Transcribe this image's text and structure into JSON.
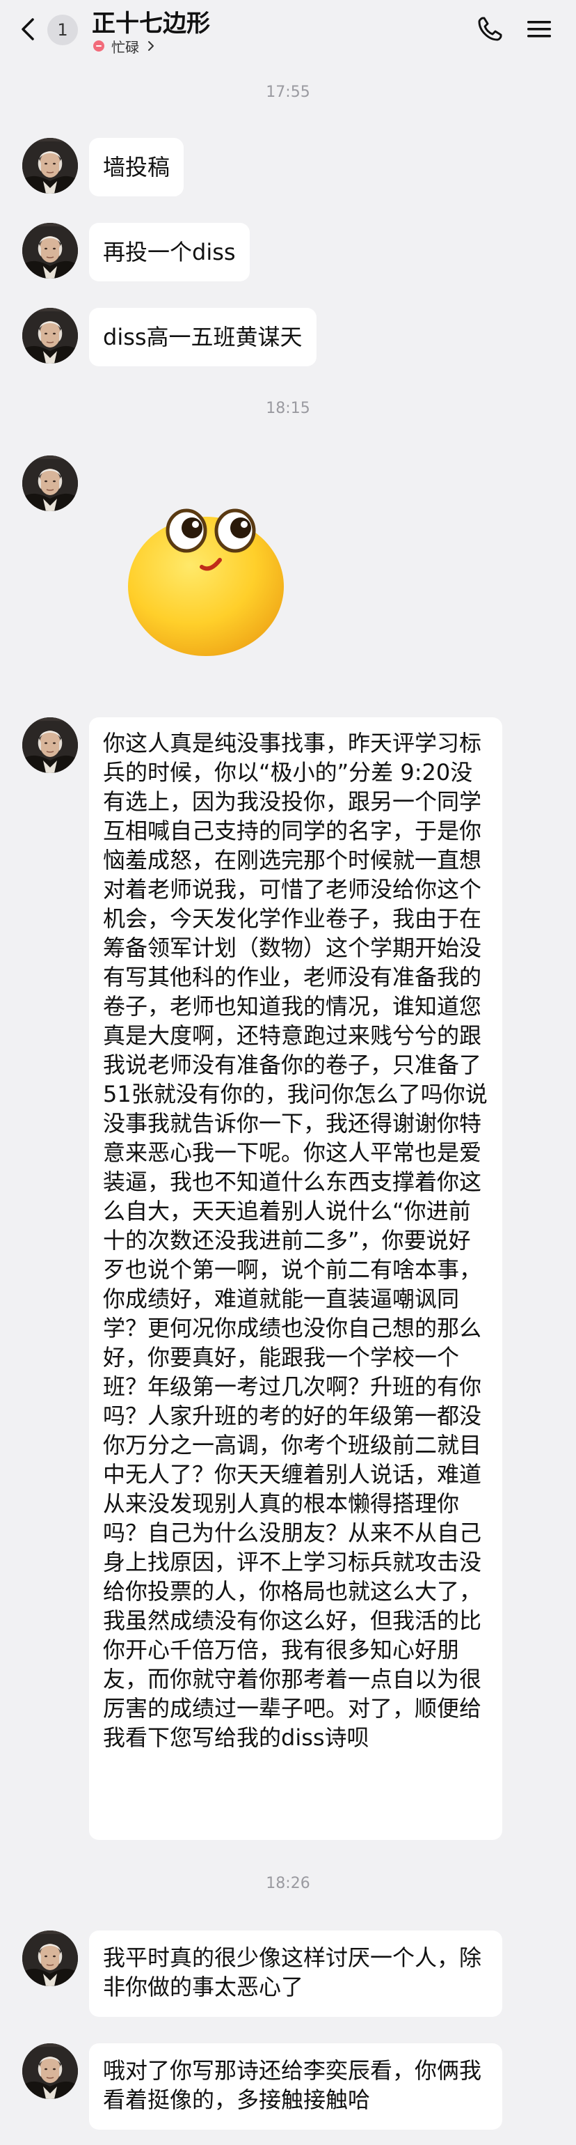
{
  "header": {
    "title": "正十七边形",
    "unread_count": "1",
    "status": "忙碌",
    "icons": {
      "back": "chevron-left-icon",
      "call": "phone-icon",
      "menu": "menu-icon"
    },
    "status_color": "#f26b7a"
  },
  "colors": {
    "background": "#f1f1f3",
    "bubble": "#ffffff",
    "timestamp": "#9a9aa0"
  },
  "messages": [
    {
      "type": "timestamp",
      "text": "17:55"
    },
    {
      "type": "text",
      "text": "墙投稿"
    },
    {
      "type": "text",
      "text": "再投一个diss"
    },
    {
      "type": "text",
      "text": "diss高一五班黄谋天"
    },
    {
      "type": "timestamp",
      "text": "18:15"
    },
    {
      "type": "sticker",
      "name": "thinking-face-emoji"
    },
    {
      "type": "text",
      "text": "你这人真是纯没事找事，昨天评学习标兵的时候，你以“极小的”分差 9:20没有选上，因为我没投你，跟另一个同学互相喊自己支持的同学的名字，于是你恼羞成怒，在刚选完那个时候就一直想对着老师说我，可惜了老师没给你这个机会，今天发化学作业卷子，我由于在筹备领军计划（数物）这个学期开始没有写其他科的作业，老师没有准备我的卷子，老师也知道我的情况，谁知道您真是大度啊，还特意跑过来贱兮兮的跟我说老师没有准备你的卷子，只准备了51张就没有你的，我问你怎么了吗你说没事我就告诉你一下，我还得谢谢你特意来恶心我一下呢。你这人平常也是爱装逼，我也不知道什么东西支撑着你这么自大，天天追着别人说什么“你进前十的次数还没我进前二多”，你要说好歹也说个第一啊，说个前二有啥本事，你成绩好，难道就能一直装逼嘲讽同学？更何况你成绩也没你自己想的那么好，你要真好，能跟我一个学校一个班？年级第一考过几次啊？升班的有你吗？人家升班的考的好的年级第一都没你万分之一高调，你考个班级前二就目中无人了？你天天缠着别人说话，难道从来没发现别人真的根本懒得搭理你吗？自己为什么没朋友？从来不从自己身上找原因，评不上学习标兵就攻击没给你投票的人，你格局也就这么大了，我虽然成绩没有你这么好，但我活的比你开心千倍万倍，我有很多知心好朋友，而你就守着你那考着一点自以为很厉害的成绩过一辈子吧。对了，顺便给我看下您写给我的diss诗呗"
    },
    {
      "type": "timestamp",
      "text": "18:26"
    },
    {
      "type": "text",
      "text": "我平时真的很少像这样讨厌一个人，除非你做的事太恶心了"
    },
    {
      "type": "text",
      "text": "哦对了你写那诗还给李奕辰看，你俩我看着挺像的，多接触接触哈"
    }
  ]
}
